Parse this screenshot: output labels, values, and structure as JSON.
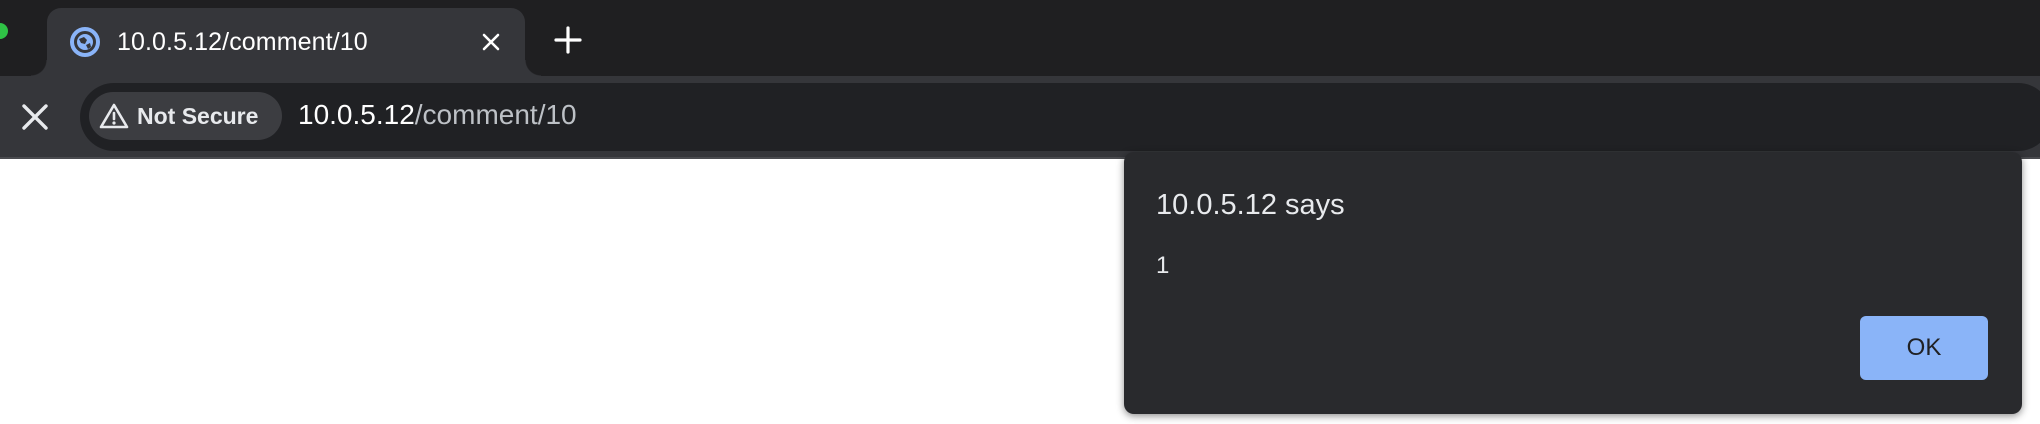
{
  "tab": {
    "title": "10.0.5.12/comment/10",
    "favicon": "globe-icon"
  },
  "toolbar": {
    "stop_icon": "close-icon",
    "security_chip_label": "Not Secure",
    "security_icon": "warning-icon",
    "url_host": "10.0.5.12",
    "url_path": "/comment/10"
  },
  "dialog": {
    "title": "10.0.5.12 says",
    "message": "1",
    "ok_label": "OK"
  },
  "colors": {
    "tabstrip": "#1f1f21",
    "active_tab": "#35363a",
    "omnibox": "#202124",
    "dialog_bg": "#292a2d",
    "ok_button": "#8ab4f8"
  }
}
